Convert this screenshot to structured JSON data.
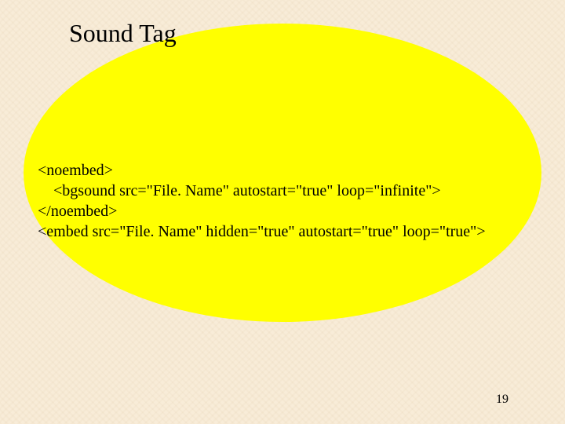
{
  "title": "Sound Tag",
  "code": {
    "line1": "<noembed>",
    "line2": "    <bgsound src=\"File. Name\" autostart=\"true\" loop=\"infinite\">",
    "line3": "</noembed>",
    "line4": "<embed src=\"File. Name\" hidden=\"true\" autostart=\"true\" loop=\"true\">"
  },
  "page_number": "19"
}
